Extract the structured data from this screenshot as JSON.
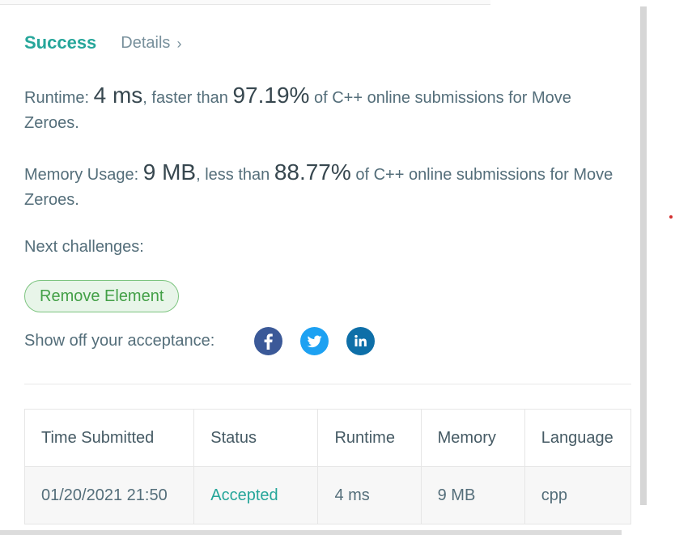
{
  "result": {
    "status": "Success",
    "details_label": "Details",
    "details_chevron": "›"
  },
  "runtime": {
    "label": "Runtime:",
    "value": "4 ms",
    "mid": ", faster than",
    "percent": "97.19%",
    "suffix": "of C++ online submissions for Move Zeroes."
  },
  "memory": {
    "label": "Memory Usage:",
    "value": "9 MB",
    "mid": ", less than",
    "percent": "88.77%",
    "suffix": "of C++ online submissions for Move Zeroes."
  },
  "next": {
    "label": "Next challenges:",
    "challenges": [
      "Remove Element"
    ]
  },
  "share": {
    "label": "Show off your acceptance:",
    "icons": [
      "facebook-icon",
      "twitter-icon",
      "linkedin-icon"
    ]
  },
  "table": {
    "headers": [
      "Time Submitted",
      "Status",
      "Runtime",
      "Memory",
      "Language"
    ],
    "rows": [
      [
        "01/20/2021 21:50",
        "Accepted",
        "4 ms",
        "9 MB",
        "cpp"
      ]
    ]
  },
  "colors": {
    "success": "#26a69a",
    "accepted": "#26a69a",
    "challenge_text": "#43a047",
    "challenge_bg": "#e8f5e9",
    "facebook": "#3b5998",
    "twitter": "#1da1f2",
    "linkedin": "#0e6fa8"
  }
}
